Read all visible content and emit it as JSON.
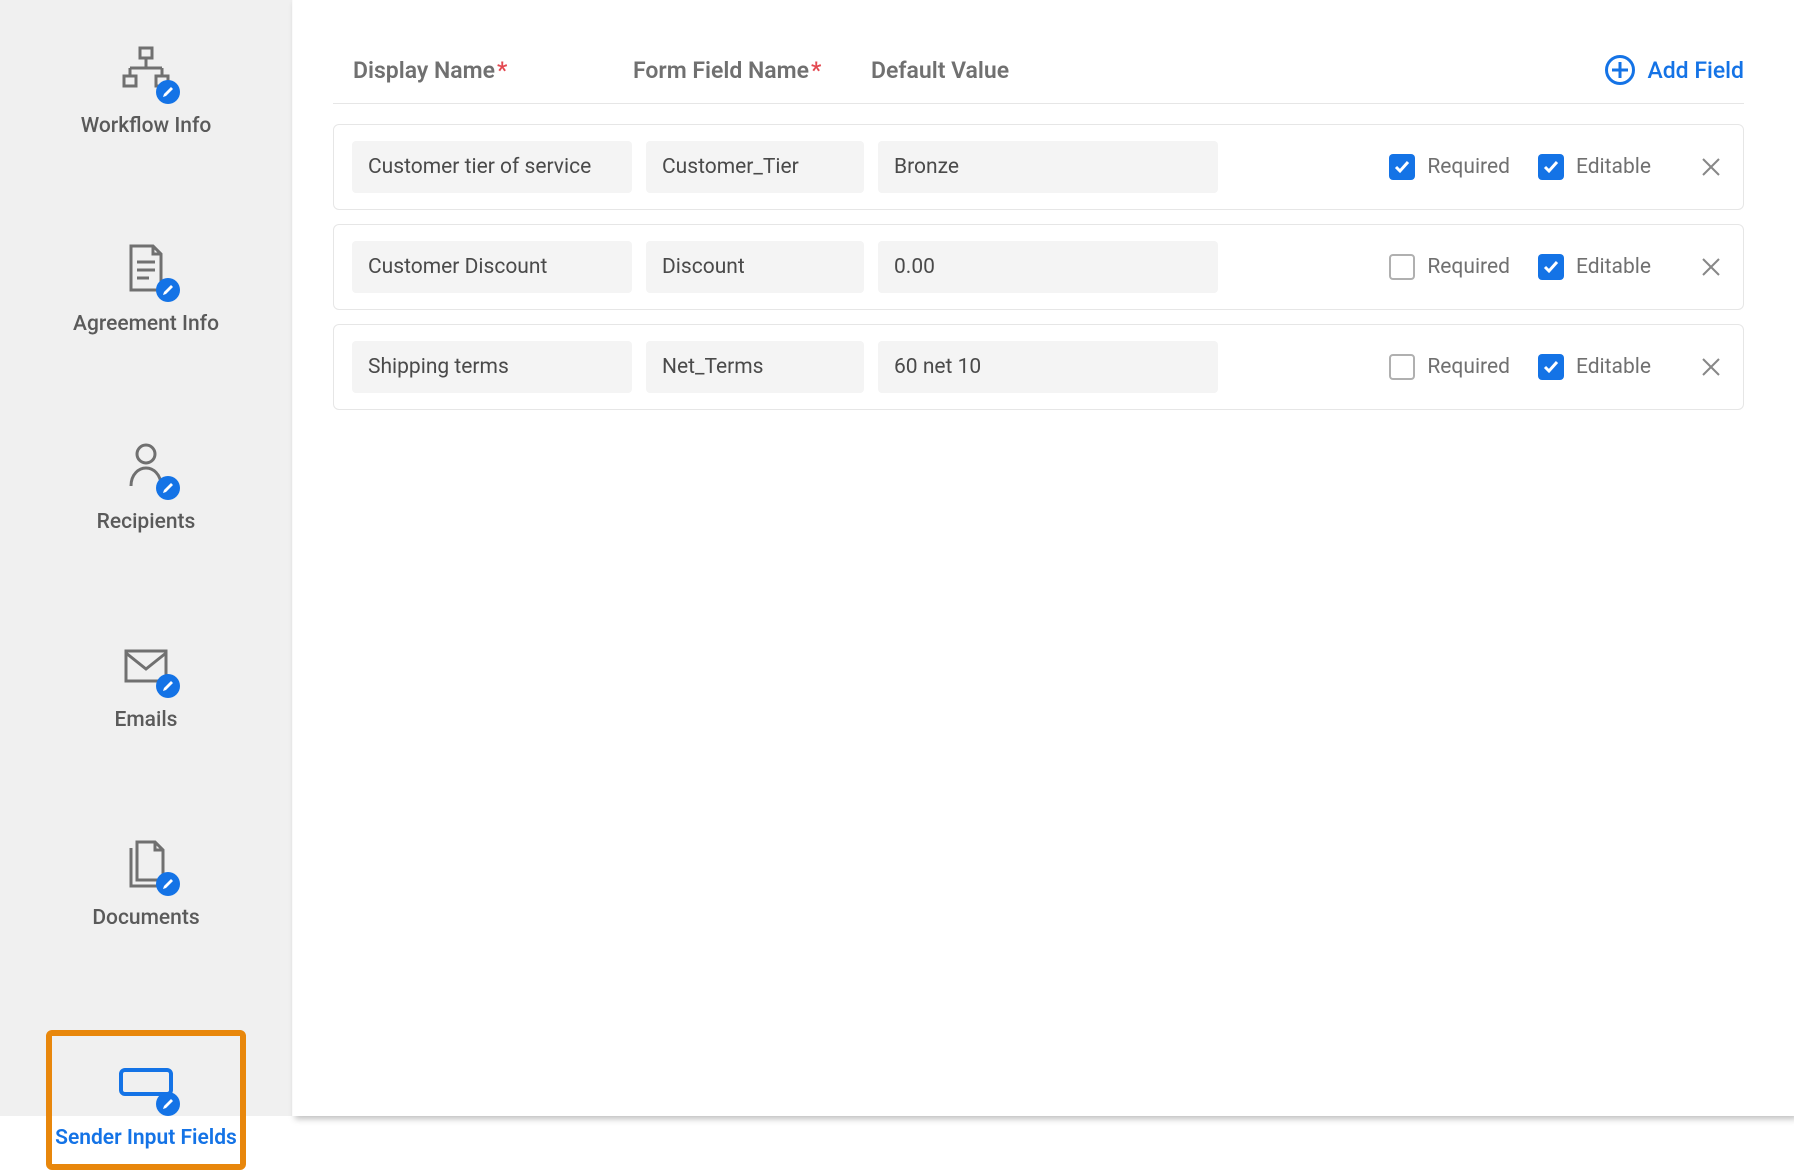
{
  "sidebar": {
    "items": [
      {
        "label": "Workflow Info"
      },
      {
        "label": "Agreement Info"
      },
      {
        "label": "Recipients"
      },
      {
        "label": "Emails"
      },
      {
        "label": "Documents"
      },
      {
        "label": "Sender Input Fields"
      }
    ]
  },
  "main": {
    "columns": {
      "display_name": "Display Name",
      "form_field_name": "Form Field Name",
      "default_value": "Default Value"
    },
    "required_mark": "*",
    "add_field_label": "Add Field",
    "checkbox_labels": {
      "required": "Required",
      "editable": "Editable"
    },
    "fields": [
      {
        "display": "Customer tier of service",
        "form": "Customer_Tier",
        "default": "Bronze",
        "required": true,
        "editable": true
      },
      {
        "display": "Customer Discount",
        "form": "Discount",
        "default": "0.00",
        "required": false,
        "editable": true
      },
      {
        "display": "Shipping terms",
        "form": "Net_Terms",
        "default": "60 net 10",
        "required": false,
        "editable": true
      }
    ]
  }
}
